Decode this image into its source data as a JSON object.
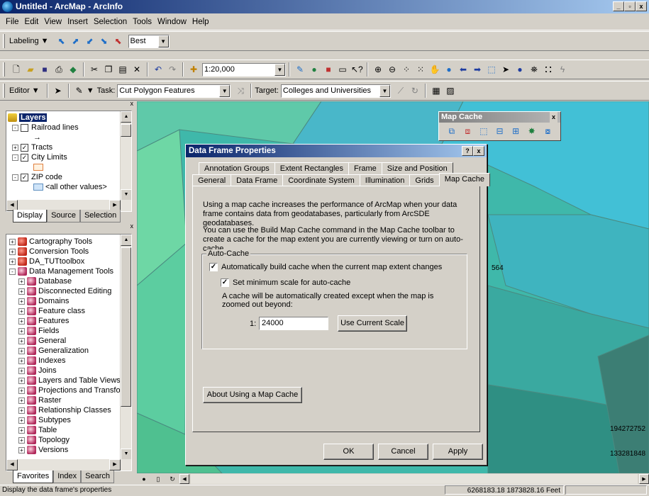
{
  "window": {
    "title": "Untitled - ArcMap - ArcInfo"
  },
  "menu": [
    "File",
    "Edit",
    "View",
    "Insert",
    "Selection",
    "Tools",
    "Window",
    "Help"
  ],
  "labeling": {
    "label": "Labeling ▼",
    "quality": "Best"
  },
  "standard": {
    "scale": "1:20,000"
  },
  "editor": {
    "label": "Editor ▼",
    "task_label": "Task:",
    "task": "Cut Polygon Features",
    "target_label": "Target:",
    "target": "Colleges and Universities"
  },
  "toc": {
    "items": [
      {
        "label": "Layers",
        "kind": "root"
      },
      {
        "label": "Railroad lines",
        "kind": "layer",
        "checked": false
      },
      {
        "label": "→",
        "kind": "sym"
      },
      {
        "label": "Tracts",
        "kind": "layer",
        "checked": true,
        "expand": "+"
      },
      {
        "label": "City Limits",
        "kind": "layer",
        "checked": true,
        "expand": "-"
      },
      {
        "label": "",
        "kind": "sym-box"
      },
      {
        "label": "ZIP code",
        "kind": "layer",
        "checked": true,
        "expand": "-"
      },
      {
        "label": "<all other values>",
        "kind": "sym-fill"
      }
    ],
    "tabs": [
      "Display",
      "Source",
      "Selection"
    ]
  },
  "toolbox": {
    "items": [
      {
        "label": "Cartography Tools",
        "level": 0,
        "icon": "red"
      },
      {
        "label": "Conversion Tools",
        "level": 0,
        "icon": "red"
      },
      {
        "label": "DA_TUTtoolbox",
        "level": 0,
        "icon": "red"
      },
      {
        "label": "Data Management Tools",
        "level": 0,
        "icon": "dm"
      },
      {
        "label": "Database",
        "level": 1,
        "icon": "dm"
      },
      {
        "label": "Disconnected Editing",
        "level": 1,
        "icon": "dm"
      },
      {
        "label": "Domains",
        "level": 1,
        "icon": "dm"
      },
      {
        "label": "Feature class",
        "level": 1,
        "icon": "dm"
      },
      {
        "label": "Features",
        "level": 1,
        "icon": "dm"
      },
      {
        "label": "Fields",
        "level": 1,
        "icon": "dm"
      },
      {
        "label": "General",
        "level": 1,
        "icon": "dm"
      },
      {
        "label": "Generalization",
        "level": 1,
        "icon": "dm"
      },
      {
        "label": "Indexes",
        "level": 1,
        "icon": "dm"
      },
      {
        "label": "Joins",
        "level": 1,
        "icon": "dm"
      },
      {
        "label": "Layers and Table Views",
        "level": 1,
        "icon": "dm"
      },
      {
        "label": "Projections and Transfo",
        "level": 1,
        "icon": "dm"
      },
      {
        "label": "Raster",
        "level": 1,
        "icon": "dm"
      },
      {
        "label": "Relationship Classes",
        "level": 1,
        "icon": "dm"
      },
      {
        "label": "Subtypes",
        "level": 1,
        "icon": "dm"
      },
      {
        "label": "Table",
        "level": 1,
        "icon": "dm"
      },
      {
        "label": "Topology",
        "level": 1,
        "icon": "dm"
      },
      {
        "label": "Versions",
        "level": 1,
        "icon": "dm"
      }
    ],
    "tabs": [
      "Favorites",
      "Index",
      "Search"
    ]
  },
  "map_labels": {
    "a": "564",
    "b": "194272752",
    "c": "133281848"
  },
  "map_cache_toolbar": {
    "title": "Map Cache",
    "close": "x"
  },
  "dialog": {
    "title": "Data Frame Properties",
    "tabs_row1": [
      "Annotation Groups",
      "Extent Rectangles",
      "Frame",
      "Size and Position"
    ],
    "tabs_row2": [
      "General",
      "Data Frame",
      "Coordinate System",
      "Illumination",
      "Grids",
      "Map Cache"
    ],
    "para1": "Using a map cache increases the performance of ArcMap when your data frame contains data from geodatabases, particularly from ArcSDE geodatabases.",
    "para2": "You can use the Build Map Cache command in the Map Cache toolbar to create a cache for the map extent you are currently viewing or turn on auto-cache.",
    "group": "Auto-Cache",
    "auto_build": "Automatically build cache when the current map extent changes",
    "min_scale": "Set minimum scale for auto-cache",
    "note": "A cache will be automatically created except when the map is zoomed out beyond:",
    "scale_prefix": "1:",
    "scale_value": "24000",
    "use_current": "Use Current Scale",
    "about": "About Using a Map Cache",
    "ok": "OK",
    "cancel": "Cancel",
    "apply": "Apply"
  },
  "status": {
    "left": "Display the data frame's properties",
    "coords": "6268183.18  1873828.16 Feet"
  }
}
